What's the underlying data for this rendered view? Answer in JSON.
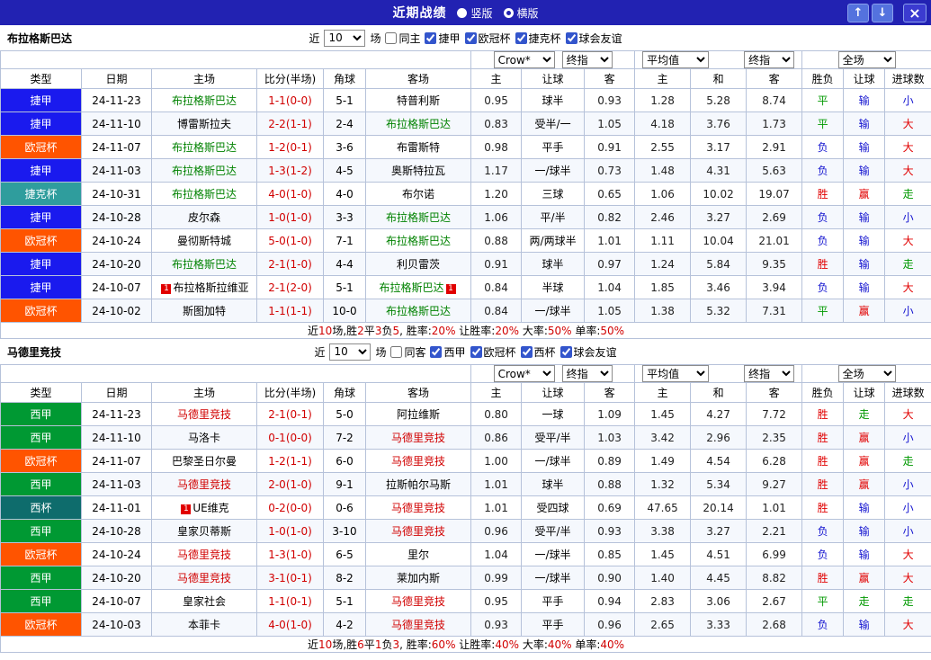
{
  "topbar": {
    "title": "近期战绩",
    "radio_vertical": "竖版",
    "radio_horizontal": "横版",
    "selected_layout": "横版",
    "up_button": "↑",
    "down_button": "↓",
    "close_button": "×"
  },
  "table_header": {
    "columns": [
      "类型",
      "日期",
      "主场",
      "比分(半场)",
      "角球",
      "客场",
      "主",
      "让球",
      "客",
      "主",
      "和",
      "客",
      "胜负",
      "让球",
      "进球数"
    ],
    "asian_odds_dropdowns": [
      "Crow*",
      "终指"
    ],
    "euro_odds_dropdowns": [
      "平均值",
      "终指"
    ],
    "result_dropdown": "全场"
  },
  "league_colors": {
    "捷甲": "#1a1aee",
    "欧冠杯": "#ff5400",
    "捷克杯": "#2f9d9d",
    "西甲": "#009933",
    "西杯": "#0e6c6c"
  },
  "result_colors": {
    "胜": "#e10000",
    "平": "#009900",
    "负": "#1515d0",
    "赢": "#e10000",
    "走": "#009900",
    "输": "#1515d0",
    "大": "#e10000",
    "小": "#1515d0"
  },
  "sections": [
    {
      "team": "布拉格斯巴达",
      "team_color": "#008200",
      "filter": {
        "near": "近",
        "count": "10",
        "games": "场",
        "checkboxes": [
          {
            "label": "同主",
            "checked": false
          },
          {
            "label": "捷甲",
            "checked": true
          },
          {
            "label": "欧冠杯",
            "checked": true
          },
          {
            "label": "捷克杯",
            "checked": true
          },
          {
            "label": "球会友谊",
            "checked": true
          }
        ]
      },
      "rows": [
        {
          "league": "捷甲",
          "date": "24-11-23",
          "home": "布拉格斯巴达",
          "home_focal": true,
          "score": "1-1(0-0)",
          "corner": "5-1",
          "away": "特普利斯",
          "away_focal": false,
          "ah": [
            "0.95",
            "球半",
            "0.93"
          ],
          "eu": [
            "1.28",
            "5.28",
            "8.74"
          ],
          "result": [
            "平",
            "输",
            "小"
          ]
        },
        {
          "league": "捷甲",
          "date": "24-11-10",
          "home": "博雷斯拉夫",
          "home_focal": false,
          "score": "2-2(1-1)",
          "corner": "2-4",
          "away": "布拉格斯巴达",
          "away_focal": true,
          "ah": [
            "0.83",
            "受半/一",
            "1.05"
          ],
          "eu": [
            "4.18",
            "3.76",
            "1.73"
          ],
          "result": [
            "平",
            "输",
            "大"
          ]
        },
        {
          "league": "欧冠杯",
          "date": "24-11-07",
          "home": "布拉格斯巴达",
          "home_focal": true,
          "score": "1-2(0-1)",
          "corner": "3-6",
          "away": "布雷斯特",
          "away_focal": false,
          "ah": [
            "0.98",
            "平手",
            "0.91"
          ],
          "eu": [
            "2.55",
            "3.17",
            "2.91"
          ],
          "result": [
            "负",
            "输",
            "大"
          ]
        },
        {
          "league": "捷甲",
          "date": "24-11-03",
          "home": "布拉格斯巴达",
          "home_focal": true,
          "score": "1-3(1-2)",
          "corner": "4-5",
          "away": "奥斯特拉瓦",
          "away_focal": false,
          "ah": [
            "1.17",
            "一/球半",
            "0.73"
          ],
          "eu": [
            "1.48",
            "4.31",
            "5.63"
          ],
          "result": [
            "负",
            "输",
            "大"
          ]
        },
        {
          "league": "捷克杯",
          "date": "24-10-31",
          "home": "布拉格斯巴达",
          "home_focal": true,
          "score": "4-0(1-0)",
          "corner": "4-0",
          "away": "布尔诺",
          "away_focal": false,
          "ah": [
            "1.20",
            "三球",
            "0.65"
          ],
          "eu": [
            "1.06",
            "10.02",
            "19.07"
          ],
          "result": [
            "胜",
            "赢",
            "走"
          ]
        },
        {
          "league": "捷甲",
          "date": "24-10-28",
          "home": "皮尔森",
          "home_focal": false,
          "score": "1-0(1-0)",
          "corner": "3-3",
          "away": "布拉格斯巴达",
          "away_focal": true,
          "ah": [
            "1.06",
            "平/半",
            "0.82"
          ],
          "eu": [
            "2.46",
            "3.27",
            "2.69"
          ],
          "result": [
            "负",
            "输",
            "小"
          ]
        },
        {
          "league": "欧冠杯",
          "date": "24-10-24",
          "home": "曼彻斯特城",
          "home_focal": false,
          "score": "5-0(1-0)",
          "corner": "7-1",
          "away": "布拉格斯巴达",
          "away_focal": true,
          "ah": [
            "0.88",
            "两/两球半",
            "1.01"
          ],
          "eu": [
            "1.11",
            "10.04",
            "21.01"
          ],
          "result": [
            "负",
            "输",
            "大"
          ]
        },
        {
          "league": "捷甲",
          "date": "24-10-20",
          "home": "布拉格斯巴达",
          "home_focal": true,
          "score": "2-1(1-0)",
          "corner": "4-4",
          "away": "利贝雷茨",
          "away_focal": false,
          "ah": [
            "0.91",
            "球半",
            "0.97"
          ],
          "eu": [
            "1.24",
            "5.84",
            "9.35"
          ],
          "result": [
            "胜",
            "输",
            "走"
          ]
        },
        {
          "league": "捷甲",
          "date": "24-10-07",
          "home": "布拉格斯拉维亚",
          "home_focal": false,
          "home_badge": "1",
          "score": "2-1(2-0)",
          "corner": "5-1",
          "away": "布拉格斯巴达",
          "away_focal": true,
          "away_badge": "1",
          "ah": [
            "0.84",
            "半球",
            "1.04"
          ],
          "eu": [
            "1.85",
            "3.46",
            "3.94"
          ],
          "result": [
            "负",
            "输",
            "大"
          ]
        },
        {
          "league": "欧冠杯",
          "date": "24-10-02",
          "home": "斯图加特",
          "home_focal": false,
          "score": "1-1(1-1)",
          "corner": "10-0",
          "away": "布拉格斯巴达",
          "away_focal": true,
          "ah": [
            "0.84",
            "一/球半",
            "1.05"
          ],
          "eu": [
            "1.38",
            "5.32",
            "7.31"
          ],
          "result": [
            "平",
            "赢",
            "小"
          ]
        }
      ],
      "summary": [
        {
          "text": "近"
        },
        {
          "text": "10",
          "red": true
        },
        {
          "text": "场,胜"
        },
        {
          "text": "2",
          "red": true
        },
        {
          "text": "平"
        },
        {
          "text": "3",
          "red": true
        },
        {
          "text": "负"
        },
        {
          "text": "5",
          "red": true
        },
        {
          "text": ", 胜率:"
        },
        {
          "text": "20%",
          "red": true
        },
        {
          "text": " 让胜率:"
        },
        {
          "text": "20%",
          "red": true
        },
        {
          "text": " 大率:"
        },
        {
          "text": "50%",
          "red": true
        },
        {
          "text": " 单率:"
        },
        {
          "text": "50%",
          "red": true
        }
      ]
    },
    {
      "team": "马德里竞技",
      "team_color": "#d10000",
      "filter": {
        "near": "近",
        "count": "10",
        "games": "场",
        "checkboxes": [
          {
            "label": "同客",
            "checked": false
          },
          {
            "label": "西甲",
            "checked": true
          },
          {
            "label": "欧冠杯",
            "checked": true
          },
          {
            "label": "西杯",
            "checked": true
          },
          {
            "label": "球会友谊",
            "checked": true
          }
        ]
      },
      "rows": [
        {
          "league": "西甲",
          "date": "24-11-23",
          "home": "马德里竞技",
          "home_focal": true,
          "score": "2-1(0-1)",
          "corner": "5-0",
          "away": "阿拉维斯",
          "away_focal": false,
          "ah": [
            "0.80",
            "一球",
            "1.09"
          ],
          "eu": [
            "1.45",
            "4.27",
            "7.72"
          ],
          "result": [
            "胜",
            "走",
            "大"
          ]
        },
        {
          "league": "西甲",
          "date": "24-11-10",
          "home": "马洛卡",
          "home_focal": false,
          "score": "0-1(0-0)",
          "corner": "7-2",
          "away": "马德里竞技",
          "away_focal": true,
          "ah": [
            "0.86",
            "受平/半",
            "1.03"
          ],
          "eu": [
            "3.42",
            "2.96",
            "2.35"
          ],
          "result": [
            "胜",
            "赢",
            "小"
          ]
        },
        {
          "league": "欧冠杯",
          "date": "24-11-07",
          "home": "巴黎圣日尔曼",
          "home_focal": false,
          "score": "1-2(1-1)",
          "corner": "6-0",
          "away": "马德里竞技",
          "away_focal": true,
          "ah": [
            "1.00",
            "一/球半",
            "0.89"
          ],
          "eu": [
            "1.49",
            "4.54",
            "6.28"
          ],
          "result": [
            "胜",
            "赢",
            "走"
          ]
        },
        {
          "league": "西甲",
          "date": "24-11-03",
          "home": "马德里竞技",
          "home_focal": true,
          "score": "2-0(1-0)",
          "corner": "9-1",
          "away": "拉斯帕尔马斯",
          "away_focal": false,
          "ah": [
            "1.01",
            "球半",
            "0.88"
          ],
          "eu": [
            "1.32",
            "5.34",
            "9.27"
          ],
          "result": [
            "胜",
            "赢",
            "小"
          ]
        },
        {
          "league": "西杯",
          "date": "24-11-01",
          "home": "UE维克",
          "home_focal": false,
          "home_badge": "1",
          "score": "0-2(0-0)",
          "corner": "0-6",
          "away": "马德里竞技",
          "away_focal": true,
          "ah": [
            "1.01",
            "受四球",
            "0.69"
          ],
          "eu": [
            "47.65",
            "20.14",
            "1.01"
          ],
          "result": [
            "胜",
            "输",
            "小"
          ]
        },
        {
          "league": "西甲",
          "date": "24-10-28",
          "home": "皇家贝蒂斯",
          "home_focal": false,
          "score": "1-0(1-0)",
          "corner": "3-10",
          "away": "马德里竞技",
          "away_focal": true,
          "ah": [
            "0.96",
            "受平/半",
            "0.93"
          ],
          "eu": [
            "3.38",
            "3.27",
            "2.21"
          ],
          "result": [
            "负",
            "输",
            "小"
          ]
        },
        {
          "league": "欧冠杯",
          "date": "24-10-24",
          "home": "马德里竞技",
          "home_focal": true,
          "score": "1-3(1-0)",
          "corner": "6-5",
          "away": "里尔",
          "away_focal": false,
          "ah": [
            "1.04",
            "一/球半",
            "0.85"
          ],
          "eu": [
            "1.45",
            "4.51",
            "6.99"
          ],
          "result": [
            "负",
            "输",
            "大"
          ]
        },
        {
          "league": "西甲",
          "date": "24-10-20",
          "home": "马德里竞技",
          "home_focal": true,
          "score": "3-1(0-1)",
          "corner": "8-2",
          "away": "莱加内斯",
          "away_focal": false,
          "ah": [
            "0.99",
            "一/球半",
            "0.90"
          ],
          "eu": [
            "1.40",
            "4.45",
            "8.82"
          ],
          "result": [
            "胜",
            "赢",
            "大"
          ]
        },
        {
          "league": "西甲",
          "date": "24-10-07",
          "home": "皇家社会",
          "home_focal": false,
          "score": "1-1(0-1)",
          "corner": "5-1",
          "away": "马德里竞技",
          "away_focal": true,
          "ah": [
            "0.95",
            "平手",
            "0.94"
          ],
          "eu": [
            "2.83",
            "3.06",
            "2.67"
          ],
          "result": [
            "平",
            "走",
            "走"
          ]
        },
        {
          "league": "欧冠杯",
          "date": "24-10-03",
          "home": "本菲卡",
          "home_focal": false,
          "score": "4-0(1-0)",
          "corner": "4-2",
          "away": "马德里竞技",
          "away_focal": true,
          "ah": [
            "0.93",
            "平手",
            "0.96"
          ],
          "eu": [
            "2.65",
            "3.33",
            "2.68"
          ],
          "result": [
            "负",
            "输",
            "大"
          ]
        }
      ],
      "summary": [
        {
          "text": "近"
        },
        {
          "text": "10",
          "red": true
        },
        {
          "text": "场,胜"
        },
        {
          "text": "6",
          "red": true
        },
        {
          "text": "平"
        },
        {
          "text": "1",
          "red": true
        },
        {
          "text": "负"
        },
        {
          "text": "3",
          "red": true
        },
        {
          "text": ", 胜率:"
        },
        {
          "text": "60%",
          "red": true
        },
        {
          "text": " 让胜率:"
        },
        {
          "text": "40%",
          "red": true
        },
        {
          "text": " 大率:"
        },
        {
          "text": "40%",
          "red": true
        },
        {
          "text": " 单率:"
        },
        {
          "text": "40%",
          "red": true
        }
      ]
    }
  ]
}
